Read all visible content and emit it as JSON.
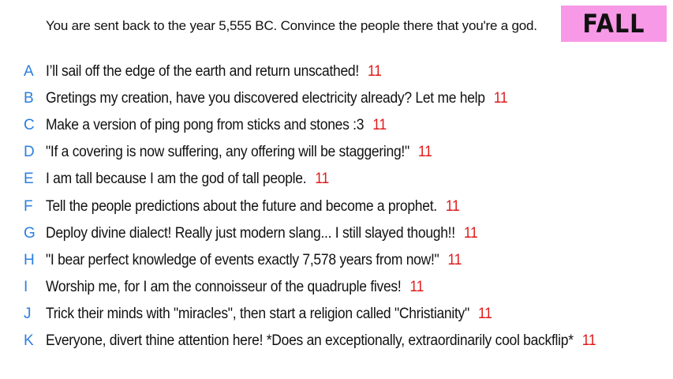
{
  "question": {
    "prompt": "You are sent back to the year 5,555 BC. Convince the people there that you're a god."
  },
  "badge": {
    "label": "FALL",
    "color": "#f799e6"
  },
  "colors": {
    "letter": "#2a7fe0",
    "score": "#e01a1a",
    "text": "#111111"
  },
  "answers": [
    {
      "letter": "A",
      "text": "I’ll sail off the edge of the earth and return unscathed!",
      "score": "11"
    },
    {
      "letter": "B",
      "text": "Gretings my creation, have you discovered electricity already? Let me help",
      "score": "11"
    },
    {
      "letter": "C",
      "text": "Make a version of ping pong from sticks and stones :3",
      "score": "11"
    },
    {
      "letter": "D",
      "text": "\"If a covering is now suffering, any offering will be staggering!\"",
      "score": "11"
    },
    {
      "letter": "E",
      "text": "I am tall because I am the god of tall people.",
      "score": "11"
    },
    {
      "letter": "F",
      "text": "Tell the people predictions about the future and become a prophet.",
      "score": "11"
    },
    {
      "letter": "G",
      "text": "Deploy divine dialect! Really just modern slang... I still slayed though!!",
      "score": "11"
    },
    {
      "letter": "H",
      "text": "\"I bear perfect knowledge of events exactly 7,578 years from now!\"",
      "score": "11"
    },
    {
      "letter": "I",
      "text": "Worship me, for I am the connoisseur of the quadruple fives!",
      "score": "11"
    },
    {
      "letter": "J",
      "text": "Trick their minds with \"miracles\", then start a religion called \"Christianity\"",
      "score": "11"
    },
    {
      "letter": "K",
      "text": "Everyone, divert thine attention here! *Does an exceptionally, extraordinarily cool backflip*",
      "score": "11"
    }
  ]
}
